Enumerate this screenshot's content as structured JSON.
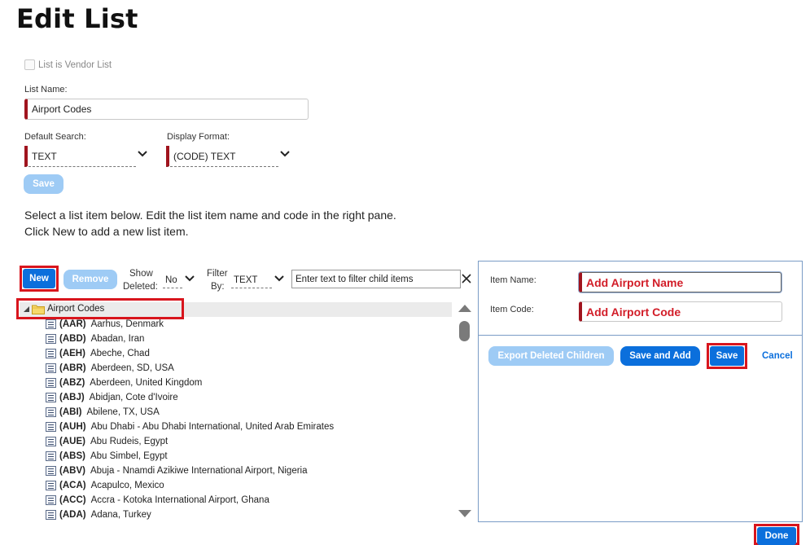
{
  "page": {
    "title": "Edit List"
  },
  "form": {
    "vendor_checkbox_label": "List is Vendor List",
    "list_name_label": "List Name:",
    "list_name_value": "Airport Codes",
    "default_search_label": "Default Search:",
    "default_search_value": "TEXT",
    "display_format_label": "Display Format:",
    "display_format_value": "(CODE) TEXT",
    "save_label": "Save"
  },
  "instructions": {
    "line1": "Select a list item below. Edit the list item name and code in the right pane.",
    "line2": "Click New to add a new list item."
  },
  "toolbar": {
    "new_label": "New",
    "remove_label": "Remove",
    "show_deleted_label_1": "Show",
    "show_deleted_label_2": "Deleted:",
    "show_deleted_value": "No",
    "filter_by_label_1": "Filter",
    "filter_by_label_2": "By:",
    "filter_by_value": "TEXT",
    "filter_placeholder": "Enter text to filter child items"
  },
  "tree": {
    "root_label": "Airport Codes",
    "items": [
      {
        "code": "(AAR)",
        "name": "Aarhus, Denmark"
      },
      {
        "code": "(ABD)",
        "name": "Abadan, Iran"
      },
      {
        "code": "(AEH)",
        "name": "Abeche, Chad"
      },
      {
        "code": "(ABR)",
        "name": "Aberdeen, SD, USA"
      },
      {
        "code": "(ABZ)",
        "name": "Aberdeen, United Kingdom"
      },
      {
        "code": "(ABJ)",
        "name": "Abidjan, Cote d'Ivoire"
      },
      {
        "code": "(ABI)",
        "name": "Abilene, TX, USA"
      },
      {
        "code": "(AUH)",
        "name": "Abu Dhabi - Abu Dhabi International, United Arab Emirates"
      },
      {
        "code": "(AUE)",
        "name": "Abu Rudeis, Egypt"
      },
      {
        "code": "(ABS)",
        "name": "Abu Simbel, Egypt"
      },
      {
        "code": "(ABV)",
        "name": "Abuja - Nnamdi Azikiwe International Airport, Nigeria"
      },
      {
        "code": "(ACA)",
        "name": "Acapulco, Mexico"
      },
      {
        "code": "(ACC)",
        "name": "Accra - Kotoka International Airport, Ghana"
      },
      {
        "code": "(ADA)",
        "name": "Adana, Turkey"
      }
    ]
  },
  "detail": {
    "item_name_label": "Item Name:",
    "item_name_value": "Add Airport Name",
    "item_code_label": "Item Code:",
    "item_code_value": "Add Airport Code",
    "export_label": "Export Deleted Children",
    "save_and_add_label": "Save and Add",
    "save_label": "Save",
    "cancel_label": "Cancel"
  },
  "footer": {
    "done_label": "Done"
  },
  "colors": {
    "accent": "#0b6fdc",
    "disabled": "#9ecbf5",
    "required": "#a0141e",
    "highlight": "#d8151d"
  },
  "icons": [
    "expand-triangle-icon",
    "folder-icon",
    "list-item-icon",
    "chevron-down-icon",
    "close-icon",
    "scroll-up-icon",
    "scroll-down-icon"
  ]
}
